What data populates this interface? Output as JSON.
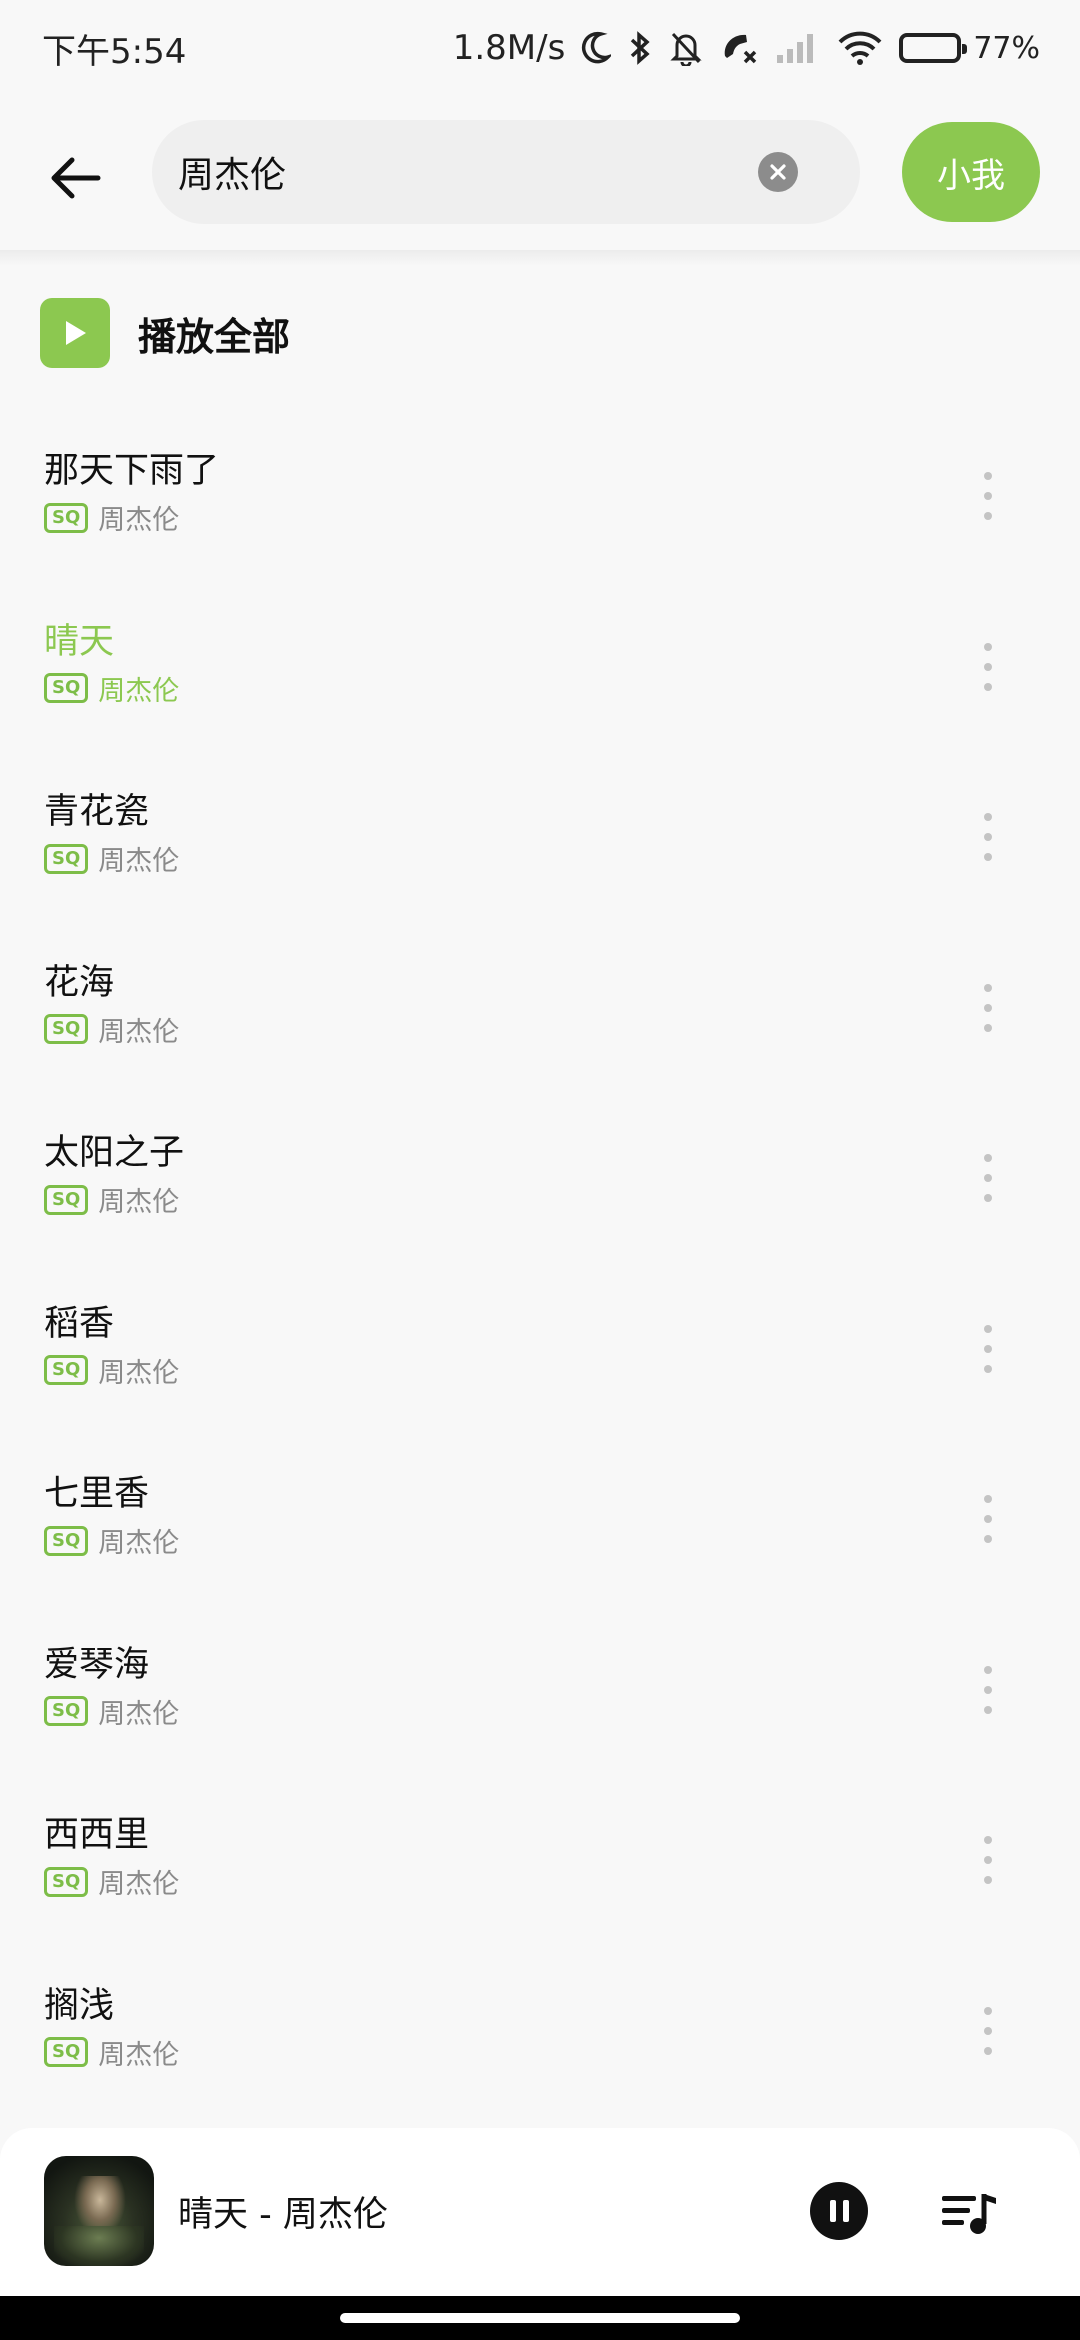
{
  "status_bar": {
    "time": "下午5:54",
    "network_speed": "1.8M/s",
    "battery": "77%",
    "battery_level": 0.77,
    "icons": [
      "moon-icon",
      "bluetooth-icon",
      "mute-bell-icon",
      "missed-call-icon",
      "signal-icon",
      "wifi-icon",
      "battery-icon"
    ]
  },
  "header": {
    "search_value": "周杰伦",
    "action_label": "小我"
  },
  "play_all": {
    "label": "播放全部"
  },
  "songs": [
    {
      "title": "那天下雨了",
      "badge": "SQ",
      "artist": "周杰伦",
      "active": false
    },
    {
      "title": "晴天",
      "badge": "SQ",
      "artist": "周杰伦",
      "active": true
    },
    {
      "title": "青花瓷",
      "badge": "SQ",
      "artist": "周杰伦",
      "active": false
    },
    {
      "title": "花海",
      "badge": "SQ",
      "artist": "周杰伦",
      "active": false
    },
    {
      "title": "太阳之子",
      "badge": "SQ",
      "artist": "周杰伦",
      "active": false
    },
    {
      "title": "稻香",
      "badge": "SQ",
      "artist": "周杰伦",
      "active": false
    },
    {
      "title": "七里香",
      "badge": "SQ",
      "artist": "周杰伦",
      "active": false
    },
    {
      "title": "爱琴海",
      "badge": "SQ",
      "artist": "周杰伦",
      "active": false
    },
    {
      "title": "西西里",
      "badge": "SQ",
      "artist": "周杰伦",
      "active": false
    },
    {
      "title": "搁浅",
      "badge": "SQ",
      "artist": "周杰伦",
      "active": false
    }
  ],
  "player": {
    "now_playing": "晴天 - 周杰伦"
  },
  "colors": {
    "accent": "#8cc850",
    "background": "#f8f8f8",
    "subtle_text": "#8a8a8a"
  }
}
